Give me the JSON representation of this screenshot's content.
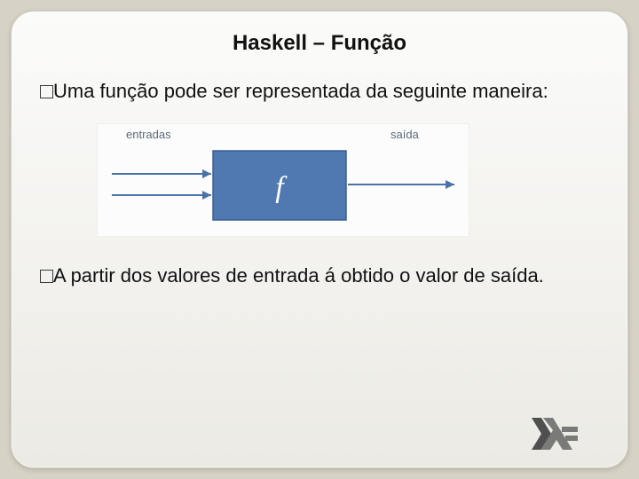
{
  "title": "Haskell – Função",
  "para1": "Uma função pode ser representada da seguinte maneira:",
  "diagram": {
    "input_label": "entradas",
    "box_label": "f",
    "output_label": "saída"
  },
  "para2": "A partir dos valores de entrada á obtido o valor de saída."
}
